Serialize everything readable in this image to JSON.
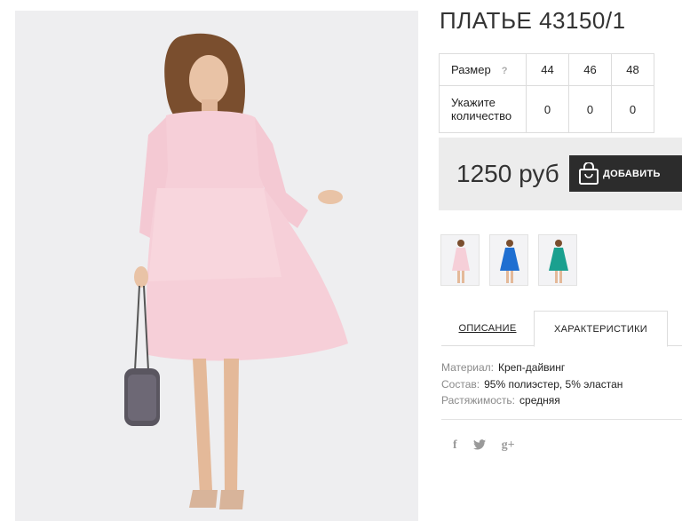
{
  "product": {
    "title": "ПЛАТЬЕ 43150/1",
    "price": "1250 руб",
    "add_to_cart_label": "ДОБАВИТЬ"
  },
  "size_table": {
    "size_label": "Размер",
    "help_glyph": "?",
    "sizes": [
      "44",
      "46",
      "48"
    ],
    "qty_label": "Укажите количество",
    "quantities": [
      "0",
      "0",
      "0"
    ]
  },
  "thumbnails": [
    {
      "color": "pink"
    },
    {
      "color": "blue"
    },
    {
      "color": "teal"
    }
  ],
  "tabs": {
    "description": "ОПИСАНИЕ",
    "characteristics": "ХАРАКТЕРИСТИКИ",
    "active": "characteristics"
  },
  "characteristics": [
    {
      "key": "Материал:",
      "value": "Креп-дайвинг"
    },
    {
      "key": "Состав:",
      "value": "95% полиэстер, 5% эластан"
    },
    {
      "key": "Растяжимость:",
      "value": "средняя"
    }
  ],
  "social": {
    "facebook": "f",
    "googleplus": "g+"
  },
  "colors": {
    "dress_pink": "#f6cfd8",
    "button_dark": "#2c2c2c",
    "price_bg": "#ececec",
    "thumb_blue": "#1f6fd1",
    "thumb_teal": "#1aa08f"
  }
}
